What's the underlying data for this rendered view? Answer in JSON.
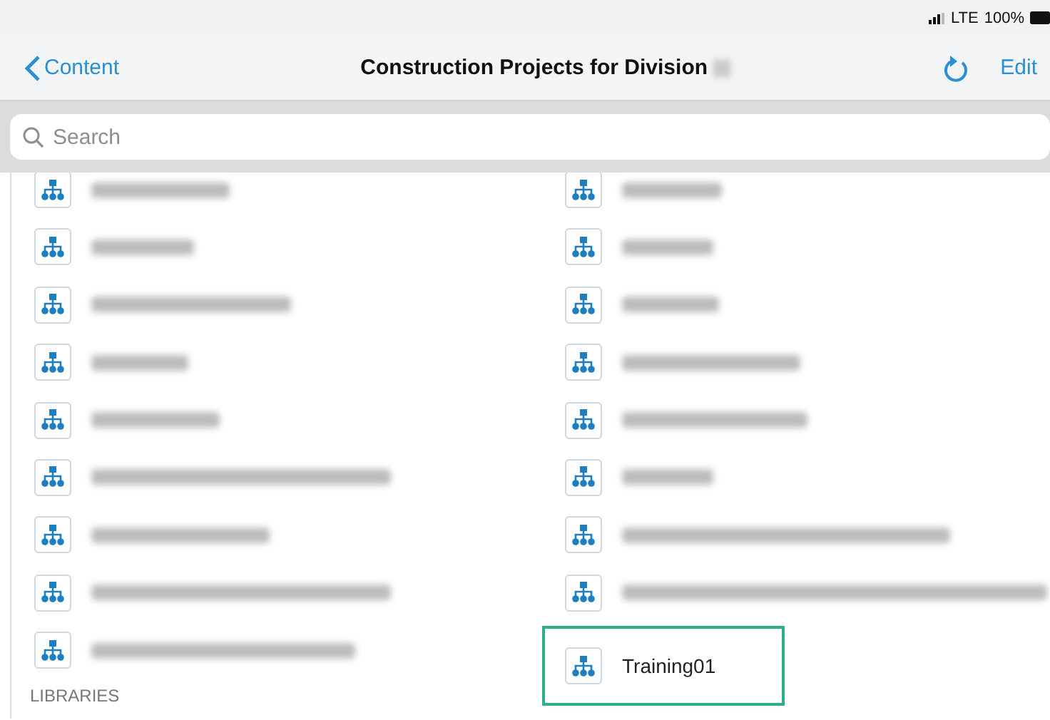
{
  "status_bar": {
    "network": "LTE",
    "battery": "100%"
  },
  "nav_bar": {
    "back": "Content",
    "title": "Construction Projects for Division",
    "title_redacted": true,
    "action": "Edit"
  },
  "search": {
    "placeholder": "Search"
  },
  "projects": [
    {
      "kind": "redacted",
      "selected": false
    },
    {
      "kind": "redacted",
      "selected": false
    },
    {
      "kind": "redacted",
      "selected": false
    },
    {
      "kind": "redacted",
      "selected": false
    },
    {
      "kind": "redacted",
      "selected": false
    },
    {
      "kind": "redacted",
      "selected": false
    },
    {
      "kind": "redacted",
      "selected": false
    },
    {
      "kind": "redacted",
      "selected": false
    },
    {
      "kind": "redacted",
      "selected": false
    },
    {
      "kind": "redacted",
      "selected": false
    },
    {
      "kind": "redacted",
      "selected": false
    },
    {
      "kind": "redacted",
      "selected": false
    },
    {
      "kind": "redacted",
      "selected": false
    },
    {
      "kind": "redacted",
      "selected": false
    },
    {
      "kind": "redacted",
      "selected": false
    },
    {
      "kind": "redacted",
      "selected": false
    },
    {
      "kind": "redacted",
      "selected": false
    },
    {
      "kind": "named",
      "label": "Training01",
      "selected": true
    }
  ],
  "section_header": "LIBRARIES"
}
